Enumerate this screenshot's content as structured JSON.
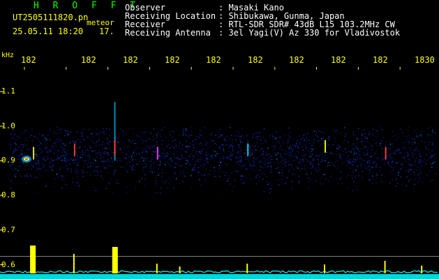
{
  "app": {
    "name": "H R O F F T"
  },
  "file": {
    "name": "UT2505111820.pn",
    "tag": "meteor"
  },
  "timestamp": {
    "date_time": "25.05.11 18:20",
    "seconds": "17."
  },
  "info": [
    {
      "label": "Observer",
      "value": ": Masaki Kano"
    },
    {
      "label": "Receiving Location",
      "value": ": Shibukawa, Gunma, Japan"
    },
    {
      "label": "Receiver",
      "value": ": RTL-SDR SDR# 43dB L15 103.2MHz CW"
    },
    {
      "label": "Receiving Antenna",
      "value": ": 3el Yagi(V) Az 330 for Vladivostok"
    }
  ],
  "colors": {
    "text": "#ffff00",
    "info": "#ffffff",
    "brand": "#00ff00",
    "background": "#000000",
    "baseline": "#00ffff",
    "peaks": "#ffff00"
  },
  "chart_data": {
    "type": "heatmap",
    "ylabel": "kHz",
    "x_ticks": [
      "182",
      "182",
      "182",
      "182",
      "182",
      "182",
      "182",
      "182",
      "182",
      "1830"
    ],
    "y_ticks": [
      "1.1",
      "1.0",
      "0.9",
      "0.8",
      "0.7",
      "0.6"
    ],
    "y_range": [
      0.58,
      1.13
    ],
    "noise_band_khz": [
      0.8,
      1.0
    ],
    "carrier_khz": 0.905,
    "streak_positions": [
      0.06,
      0.155,
      0.248,
      0.347,
      0.556,
      0.735,
      0.875
    ],
    "activity_peaks": [
      {
        "pos": 0.06,
        "level": 1.0
      },
      {
        "pos": 0.248,
        "level": 0.78
      },
      {
        "pos": 0.25,
        "level": 0.95
      },
      {
        "pos": 0.155,
        "level": 0.7
      },
      {
        "pos": 0.347,
        "level": 0.35
      },
      {
        "pos": 0.4,
        "level": 0.25
      },
      {
        "pos": 0.556,
        "level": 0.35
      },
      {
        "pos": 0.735,
        "level": 0.32
      },
      {
        "pos": 0.875,
        "level": 0.45
      },
      {
        "pos": 0.96,
        "level": 0.28
      }
    ]
  }
}
